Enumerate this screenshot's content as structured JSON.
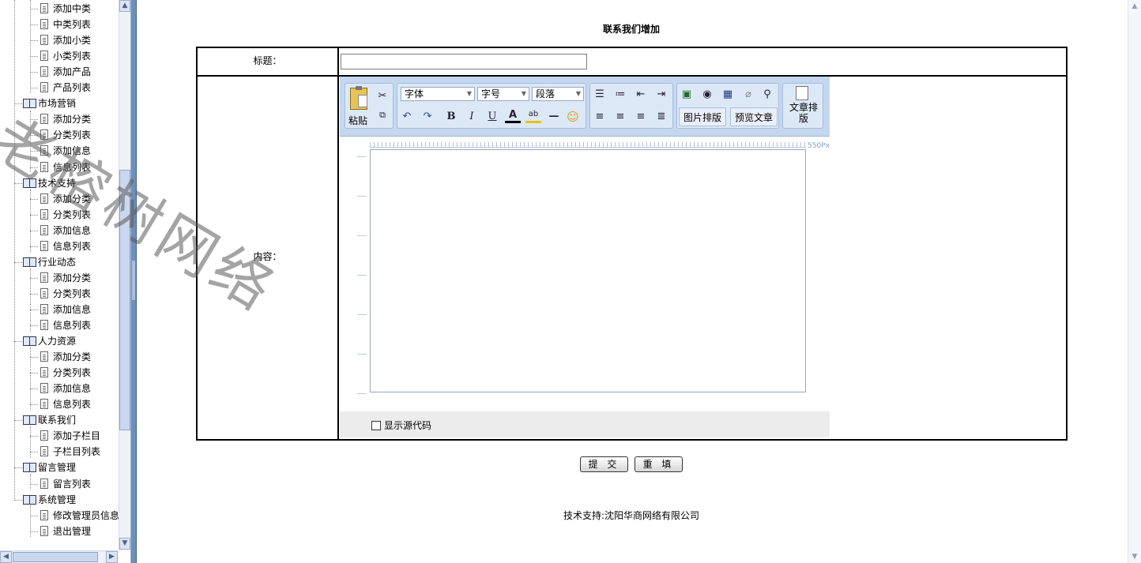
{
  "watermark": "老榕树网络",
  "tree": {
    "items": [
      {
        "label": "添加中类",
        "type": "doc"
      },
      {
        "label": "中类列表",
        "type": "doc"
      },
      {
        "label": "添加小类",
        "type": "doc"
      },
      {
        "label": "小类列表",
        "type": "doc"
      },
      {
        "label": "添加产品",
        "type": "doc"
      },
      {
        "label": "产品列表",
        "type": "doc"
      },
      {
        "label": "市场营销",
        "type": "folder"
      },
      {
        "label": "添加分类",
        "type": "doc"
      },
      {
        "label": "分类列表",
        "type": "doc"
      },
      {
        "label": "添加信息",
        "type": "doc"
      },
      {
        "label": "信息列表",
        "type": "doc"
      },
      {
        "label": "技术支持",
        "type": "folder"
      },
      {
        "label": "添加分类",
        "type": "doc"
      },
      {
        "label": "分类列表",
        "type": "doc"
      },
      {
        "label": "添加信息",
        "type": "doc"
      },
      {
        "label": "信息列表",
        "type": "doc"
      },
      {
        "label": "行业动态",
        "type": "folder"
      },
      {
        "label": "添加分类",
        "type": "doc"
      },
      {
        "label": "分类列表",
        "type": "doc"
      },
      {
        "label": "添加信息",
        "type": "doc"
      },
      {
        "label": "信息列表",
        "type": "doc"
      },
      {
        "label": "人力资源",
        "type": "folder"
      },
      {
        "label": "添加分类",
        "type": "doc"
      },
      {
        "label": "分类列表",
        "type": "doc"
      },
      {
        "label": "添加信息",
        "type": "doc"
      },
      {
        "label": "信息列表",
        "type": "doc"
      },
      {
        "label": "联系我们",
        "type": "folder"
      },
      {
        "label": "添加子栏目",
        "type": "doc"
      },
      {
        "label": "子栏目列表",
        "type": "doc"
      },
      {
        "label": "留言管理",
        "type": "folder"
      },
      {
        "label": "留言列表",
        "type": "doc"
      },
      {
        "label": "系统管理",
        "type": "folder"
      },
      {
        "label": "修改管理员信息",
        "type": "doc"
      },
      {
        "label": "退出管理",
        "type": "doc"
      }
    ]
  },
  "page": {
    "title": "联系我们增加",
    "title_label": "标题：",
    "title_value": "",
    "content_label": "内容："
  },
  "editor": {
    "paste_label": "粘贴",
    "font_select": "字体",
    "size_select": "字号",
    "paragraph_select": "段落",
    "image_layout_button": "图片排版",
    "preview_button": "预览文章",
    "article_layout_button": "文章排版",
    "ruler_unit": "550Px",
    "show_source_label": "显示源代码",
    "show_source_checked": false
  },
  "actions": {
    "submit": "提 交",
    "reset": "重 填"
  },
  "footer": {
    "text": "技术支持:沈阳华商网络有限公司"
  }
}
